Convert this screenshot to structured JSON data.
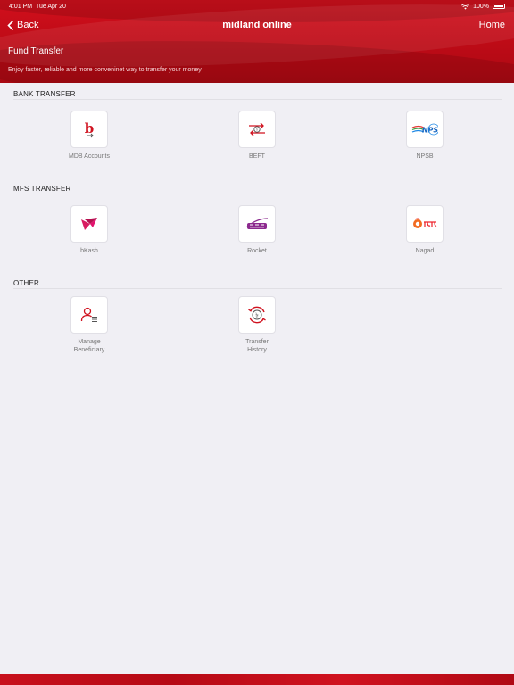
{
  "status": {
    "time": "4:01 PM",
    "date": "Tue Apr 20",
    "battery": "100%"
  },
  "nav": {
    "back": "Back",
    "title": "midland online",
    "home": "Home"
  },
  "page": {
    "title": "Fund Transfer",
    "subtitle": "Enjoy faster, reliable and more conveninet way to transfer your money"
  },
  "sections": {
    "bank": {
      "title": "BANK TRANSFER",
      "items": [
        {
          "label": "MDB Accounts",
          "icon": "mdb-accounts-icon"
        },
        {
          "label": "BEFT",
          "icon": "beft-transfer-icon"
        },
        {
          "label": "NPSB",
          "icon": "npsb-logo-icon"
        }
      ]
    },
    "mfs": {
      "title": "MFS TRANSFER",
      "items": [
        {
          "label": "bKash",
          "icon": "bkash-logo-icon"
        },
        {
          "label": "Rocket",
          "icon": "rocket-logo-icon"
        },
        {
          "label": "Nagad",
          "icon": "nagad-logo-icon"
        }
      ]
    },
    "other": {
      "title": "OTHER",
      "items": [
        {
          "label_line1": "Manage",
          "label_line2": "Beneficiary",
          "icon": "manage-beneficiary-icon"
        },
        {
          "label_line1": "Transfer",
          "label_line2": "History",
          "icon": "transfer-history-icon"
        }
      ]
    }
  },
  "colors": {
    "brand_red": "#c40c18",
    "background": "#f0eff4",
    "rocket_purple": "#8c2a8e",
    "nagad_orange": "#f26b21"
  }
}
